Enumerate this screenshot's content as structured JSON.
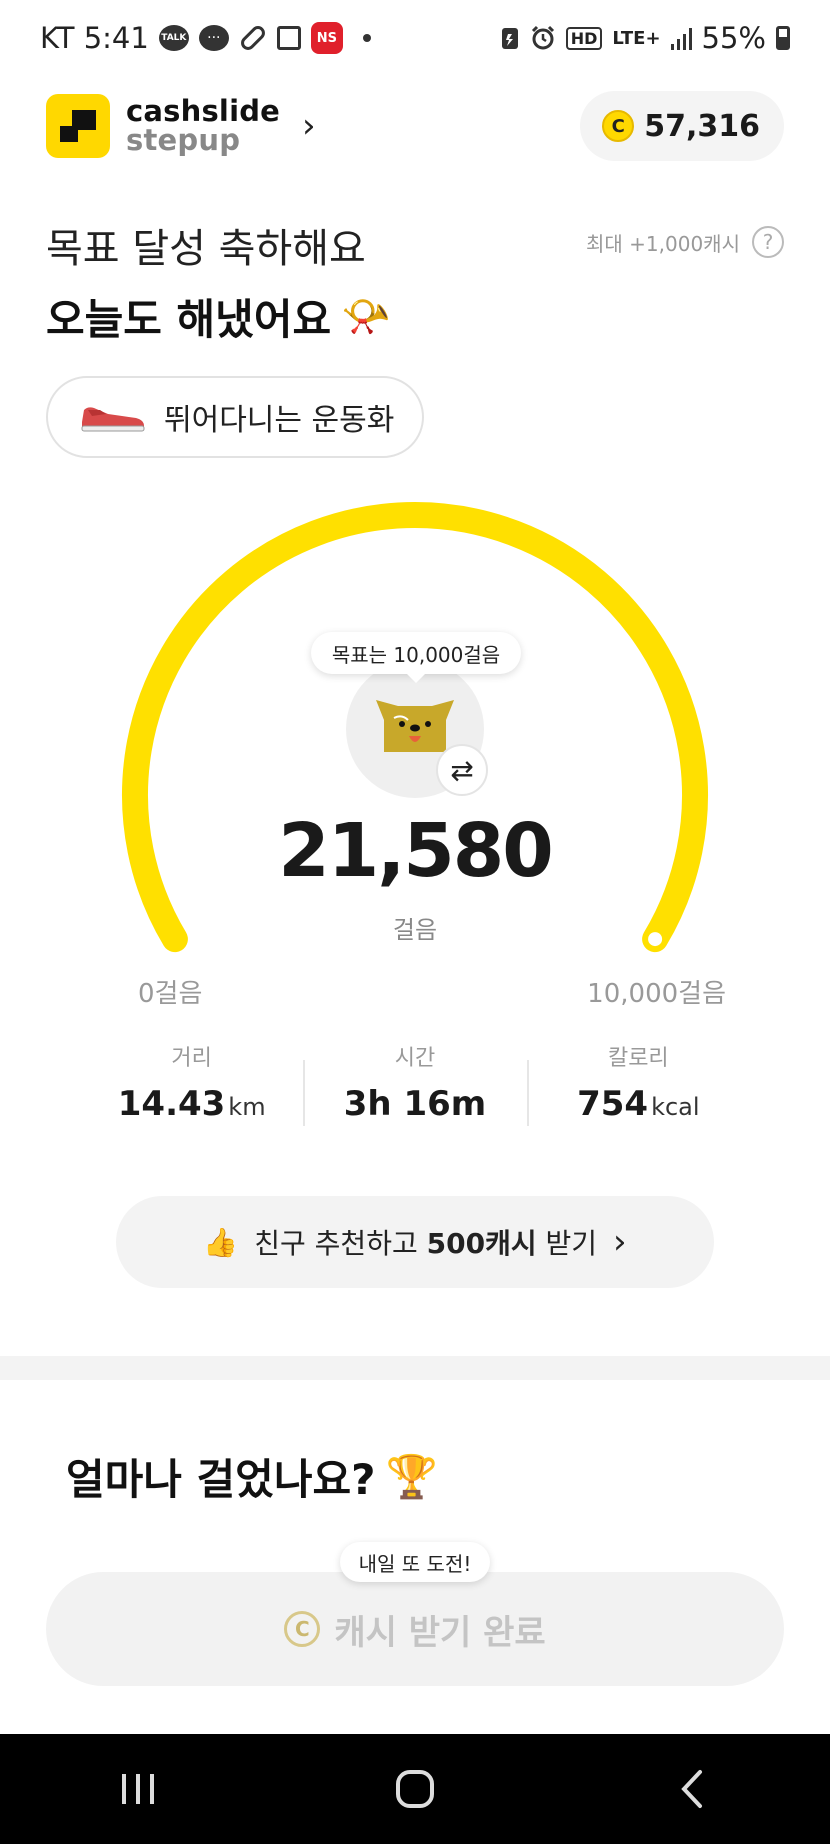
{
  "status_bar": {
    "carrier_time": "KT 5:41",
    "talk_label": "TALK",
    "ns_label": "NS",
    "hd_label": "HD",
    "network_label": "LTE+",
    "battery": "55%"
  },
  "header": {
    "brand_line1": "cashslide",
    "brand_line2": "stepup",
    "coin_symbol": "C",
    "cash_balance": "57,316"
  },
  "hero": {
    "title_line1": "목표 달성 축하해요",
    "title_line2": "오늘도 해냈어요",
    "max_reward": "최대 +1,000캐시",
    "help_symbol": "?",
    "item_name": "뛰어다니는 운동화"
  },
  "gauge": {
    "goal_bubble": "목표는 10,000걸음",
    "steps": "21,580",
    "steps_unit": "걸음",
    "min_label": "0걸음",
    "max_label": "10,000걸음",
    "progress": 1.0,
    "color": "#FFE000"
  },
  "stats": [
    {
      "label": "거리",
      "value": "14.43",
      "unit": "km"
    },
    {
      "label": "시간",
      "value": "3h 16m",
      "unit": ""
    },
    {
      "label": "칼로리",
      "value": "754",
      "unit": "kcal"
    }
  ],
  "referral": {
    "prefix": "친구 추천하고 ",
    "bold": "500캐시",
    "suffix": " 받기"
  },
  "section": {
    "question": "얼마나 걸었나요?",
    "tooltip": "내일 또 도전!",
    "claim_label": "캐시 받기 완료"
  },
  "colors": {
    "brand_yellow": "#FFD800",
    "accent_red": "#E0202B"
  }
}
